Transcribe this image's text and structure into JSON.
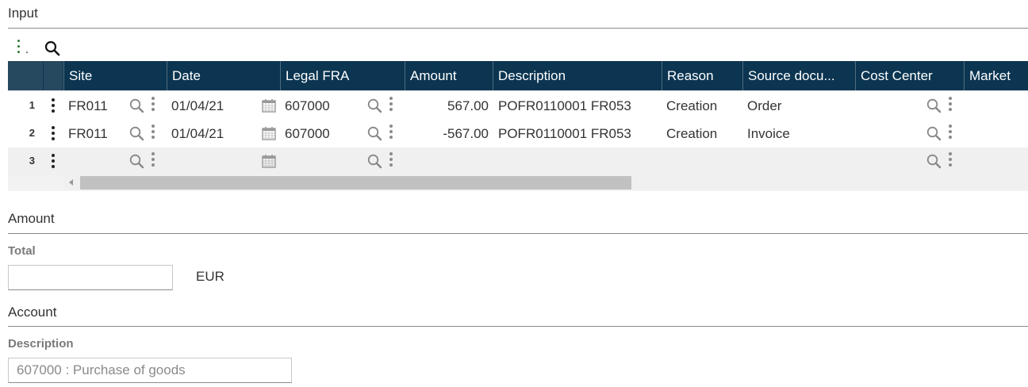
{
  "sections": {
    "input_title": "Input",
    "amount_title": "Amount",
    "account_title": "Account"
  },
  "toolbar": {
    "menu_icon": "vertical-dots-icon",
    "search_icon": "search-icon"
  },
  "table": {
    "columns": [
      "Site",
      "Date",
      "Legal FRA",
      "Amount",
      "Description",
      "Reason",
      "Source docu...",
      "Cost Center",
      "Market"
    ],
    "rows": [
      {
        "num": "1",
        "site": "FR011",
        "date": "01/04/21",
        "legal": "607000",
        "amount": "567.00",
        "description": "POFR0110001 FR053",
        "reason": "Creation",
        "source": "Order",
        "cost_center": "",
        "market": ""
      },
      {
        "num": "2",
        "site": "FR011",
        "date": "01/04/21",
        "legal": "607000",
        "amount": "-567.00",
        "description": "POFR0110001 FR053",
        "reason": "Creation",
        "source": "Invoice",
        "cost_center": "",
        "market": ""
      },
      {
        "num": "3",
        "site": "",
        "date": "",
        "legal": "",
        "amount": "",
        "description": "",
        "reason": "",
        "source": "",
        "cost_center": "",
        "market": ""
      }
    ]
  },
  "amount": {
    "total_label": "Total",
    "total_value": "",
    "currency": "EUR"
  },
  "account": {
    "description_label": "Description",
    "description_value": "607000 : Purchase of goods"
  },
  "colors": {
    "header_bg": "#0b3551",
    "accent_green": "#2e7d32"
  }
}
